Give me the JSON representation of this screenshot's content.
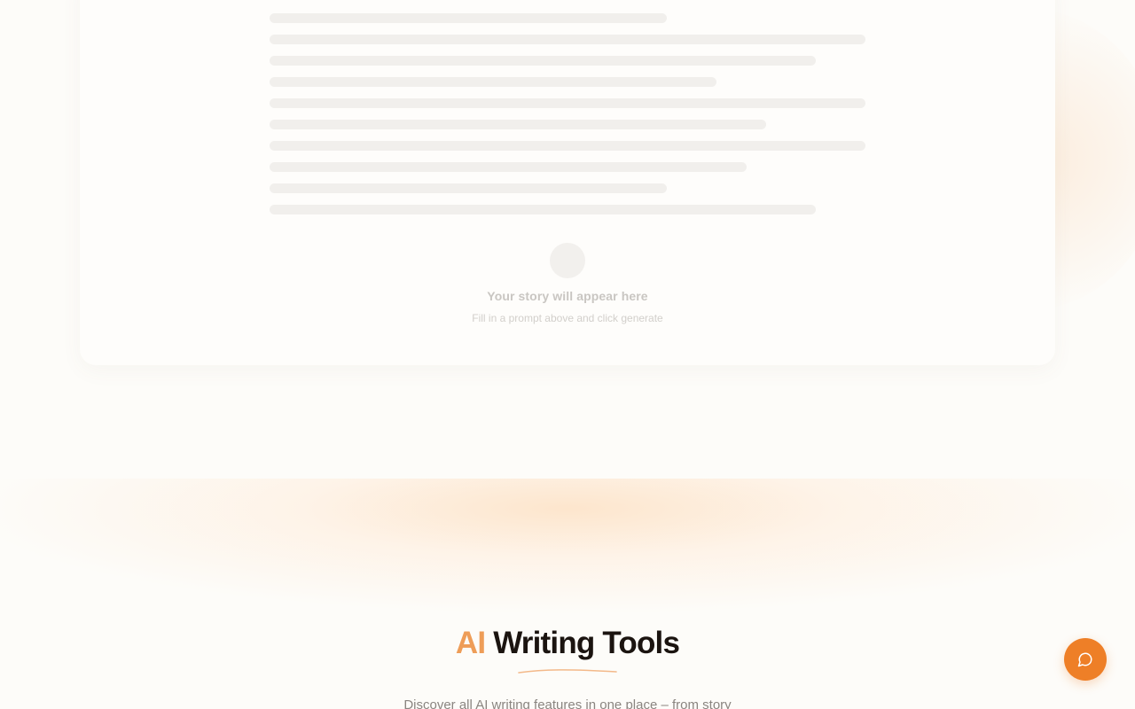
{
  "output_panel": {
    "empty_title": "Your story will appear here",
    "empty_subtitle": "Fill in a prompt above and click generate"
  },
  "section": {
    "title_accent": "AI",
    "title_main": "Writing Tools",
    "description": "Discover all AI writing features in one place – from story"
  },
  "chat": {
    "icon": "chat-bubble-icon",
    "color": "#ee7f27"
  },
  "colors": {
    "accent": "#ee9d58",
    "heading": "#1b1410",
    "background": "#fdfcf9",
    "skeleton": "#f1efec"
  }
}
